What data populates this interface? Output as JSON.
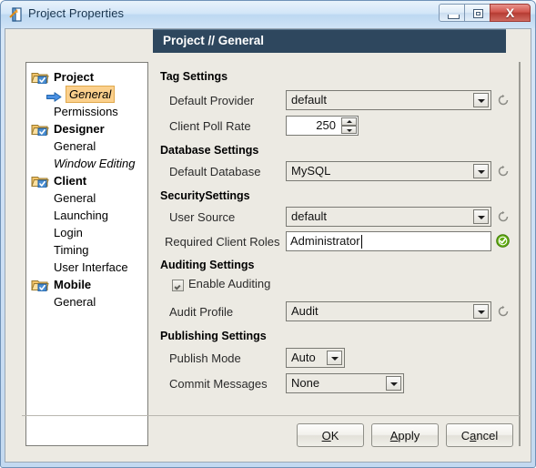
{
  "window": {
    "title": "Project Properties",
    "icon": "project-properties-icon",
    "controls": {
      "minimize": "minimize-button",
      "maximize": "maximize-button",
      "close_label": "X"
    }
  },
  "tree": {
    "nodes": [
      {
        "label": "Project",
        "type": "group",
        "icon": "folder-check-icon",
        "selected": false
      },
      {
        "label": "General",
        "type": "child",
        "icon": "blue-arrow-icon",
        "selected": true,
        "italic": true
      },
      {
        "label": "Permissions",
        "type": "child",
        "selected": false
      },
      {
        "label": "Designer",
        "type": "group",
        "icon": "folder-check-icon",
        "selected": false
      },
      {
        "label": "General",
        "type": "child",
        "selected": false
      },
      {
        "label": "Window Editing",
        "type": "child",
        "selected": false,
        "italic": true
      },
      {
        "label": "Client",
        "type": "group",
        "icon": "folder-check-icon",
        "selected": false
      },
      {
        "label": "General",
        "type": "child",
        "selected": false
      },
      {
        "label": "Launching",
        "type": "child",
        "selected": false
      },
      {
        "label": "Login",
        "type": "child",
        "selected": false
      },
      {
        "label": "Timing",
        "type": "child",
        "selected": false
      },
      {
        "label": "User Interface",
        "type": "child",
        "selected": false
      },
      {
        "label": "Mobile",
        "type": "group",
        "icon": "folder-check-icon",
        "selected": false
      },
      {
        "label": "General",
        "type": "child",
        "selected": false
      }
    ]
  },
  "panel": {
    "header": "Project // General",
    "groups": {
      "tag": "Tag Settings",
      "database": "Database Settings",
      "security": "SecuritySettings",
      "auditing": "Auditing Settings",
      "publishing": "Publishing Settings"
    },
    "fields": {
      "default_provider": {
        "label": "Default Provider",
        "value": "default"
      },
      "client_poll_rate": {
        "label": "Client Poll Rate",
        "value": "250"
      },
      "default_database": {
        "label": "Default Database",
        "value": "MySQL"
      },
      "user_source": {
        "label": "User Source",
        "value": "default"
      },
      "required_client_roles": {
        "label": "Required Client Roles",
        "value": "Administrator"
      },
      "enable_auditing": {
        "label": "Enable Auditing",
        "checked": true
      },
      "audit_profile": {
        "label": "Audit Profile",
        "value": "Audit"
      },
      "publish_mode": {
        "label": "Publish Mode",
        "value": "Auto"
      },
      "commit_messages": {
        "label": "Commit Messages",
        "value": "None"
      }
    },
    "icons": {
      "refresh": "refresh-icon",
      "valid": "green-check-icon"
    }
  },
  "buttons": {
    "ok": {
      "pre": "",
      "mnemonic": "O",
      "post": "K"
    },
    "apply": {
      "pre": "",
      "mnemonic": "A",
      "post": "pply"
    },
    "cancel": {
      "pre": "C",
      "mnemonic": "a",
      "post": "ncel"
    }
  },
  "colors": {
    "header_bg": "#2e475e",
    "selection": "#fbd08c",
    "panel_bg": "#eceae3",
    "titlebar": "#cfe3f6",
    "close_red": "#b63c33",
    "valid_green": "#5aa513"
  }
}
